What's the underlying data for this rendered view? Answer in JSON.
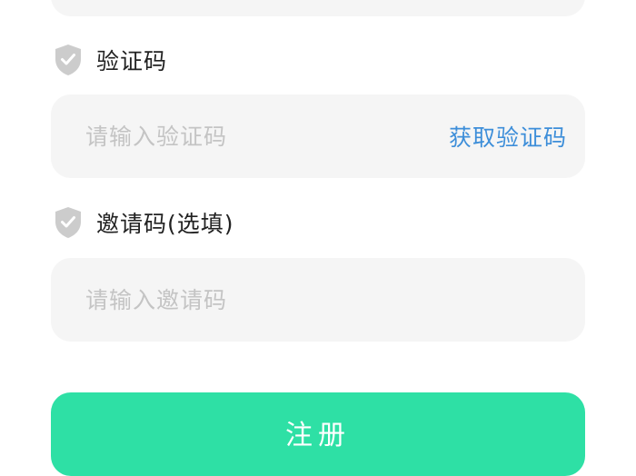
{
  "form": {
    "verify_code": {
      "label": "验证码",
      "placeholder": "请输入验证码",
      "get_code_label": "获取验证码"
    },
    "invite_code": {
      "label": "邀请码(选填)",
      "placeholder": "请输入邀请码"
    },
    "register_label": "注册"
  },
  "colors": {
    "accent_button": "#2ee0a5",
    "link": "#3d8ed9",
    "input_bg": "#f5f5f5",
    "icon_gray": "#cccccc"
  },
  "icons": {
    "verify_code": "shield-check-icon",
    "invite_code": "shield-check-icon"
  }
}
